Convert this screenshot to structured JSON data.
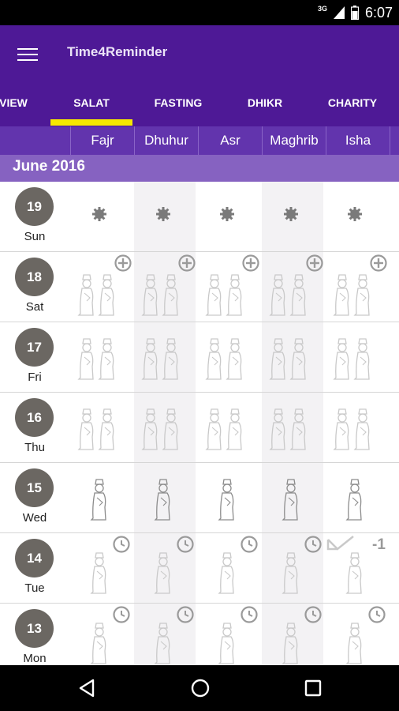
{
  "status_bar": {
    "network": "3G",
    "time": "6:07"
  },
  "app_bar": {
    "title": "Time4Reminder"
  },
  "tabs": [
    {
      "label": "VIEW"
    },
    {
      "label": "SALAT"
    },
    {
      "label": "FASTING"
    },
    {
      "label": "DHIKR"
    },
    {
      "label": "CHARITY"
    }
  ],
  "selected_tab": "SALAT",
  "prayers": [
    "Fajr",
    "Dhuhur",
    "Asr",
    "Maghrib",
    "Isha"
  ],
  "month_label": "June 2016",
  "days": [
    {
      "num": "19",
      "name": "Sun",
      "status": "dot"
    },
    {
      "num": "18",
      "name": "Sat",
      "status": "add"
    },
    {
      "num": "17",
      "name": "Fri",
      "status": "group"
    },
    {
      "num": "16",
      "name": "Thu",
      "status": "group"
    },
    {
      "num": "15",
      "name": "Wed",
      "status": "single"
    },
    {
      "num": "14",
      "name": "Tue",
      "status": "clock"
    },
    {
      "num": "13",
      "name": "Mon",
      "status": "clock"
    }
  ],
  "isha_14_badge": "-1",
  "colors": {
    "primary": "#4e1996",
    "header": "#6234ad",
    "month": "#8662c1",
    "indicator": "#f6e800",
    "day_circle": "#6b6762"
  }
}
